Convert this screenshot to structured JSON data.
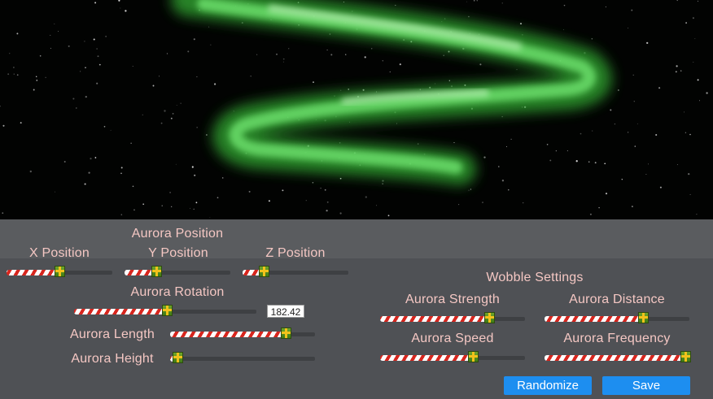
{
  "position_panel": {
    "title": "Aurora Position",
    "x_label": "X Position",
    "y_label": "Y Position",
    "z_label": "Z Position",
    "x_value": 0.5,
    "y_value": 0.3,
    "z_value": 0.2
  },
  "rotation": {
    "label": "Aurora Rotation",
    "value_text": "182.42",
    "value": 0.51
  },
  "length": {
    "label": "Aurora Length",
    "value": 0.8
  },
  "height": {
    "label": "Aurora Height",
    "value": 0.05
  },
  "wobble": {
    "title": "Wobble Settings",
    "strength_label": "Aurora Strength",
    "distance_label": "Aurora Distance",
    "speed_label": "Aurora Speed",
    "frequency_label": "Aurora Frequency",
    "strength_value": 0.75,
    "distance_value": 0.68,
    "speed_value": 0.64,
    "frequency_value": 0.97
  },
  "buttons": {
    "randomize_label": "Randomize",
    "save_label": "Save"
  },
  "colors": {
    "label": "#f4c7c3",
    "button": "#1d8ef0",
    "aurora": "#4fe04f"
  }
}
